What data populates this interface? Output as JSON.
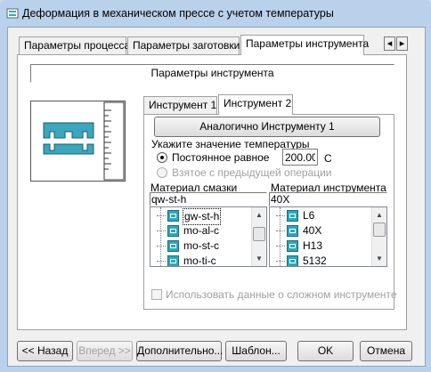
{
  "window": {
    "title": "Деформация в механическом прессе с учетом температуры"
  },
  "tabs": [
    {
      "label": "Параметры процесса",
      "active": false
    },
    {
      "label": "Параметры заготовки",
      "active": false
    },
    {
      "label": "Параметры инструмента",
      "active": true
    }
  ],
  "tab_scroll": {
    "left": "◂",
    "right": "▸"
  },
  "panel": {
    "header": "Параметры инструмента",
    "inner_tabs": [
      {
        "label": "Инструмент 1",
        "active": false
      },
      {
        "label": "Инструмент 2",
        "active": true
      }
    ],
    "same_as_button": "Аналогично Инструменту 1",
    "temperature": {
      "label": "Укажите значение температуры",
      "option_constant": "Постоянное равное",
      "option_constant_selected": true,
      "value": "200.00",
      "unit": "C",
      "option_previous": "Взятое с предыдущей операции",
      "option_previous_enabled": false
    },
    "lubricant": {
      "label": "Материал смазки",
      "selected": "qw-st-h",
      "items": [
        "gw-st-h",
        "mo-al-c",
        "mo-st-c",
        "mo-ti-c",
        "--"
      ]
    },
    "tool_material": {
      "label": "Материал инструмента",
      "selected": "40X",
      "items": [
        "L6",
        "40X",
        "H13",
        "5132",
        "..."
      ]
    },
    "complex_tool_checkbox": "Использовать данные о сложном инструменте"
  },
  "buttons": {
    "back": "<< Назад",
    "next": "Вперед >>",
    "more": "Дополнительно...",
    "template": "Шаблон...",
    "ok": "OK",
    "cancel": "Отмена"
  },
  "colors": {
    "die": "#3aa7bd",
    "icon": "#2aa9b9",
    "title_bar": "#b9d1ea"
  }
}
